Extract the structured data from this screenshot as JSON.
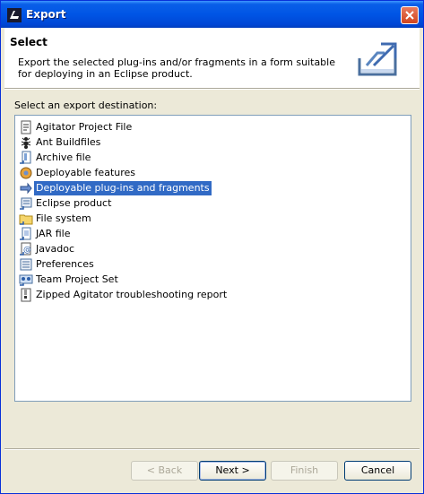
{
  "window": {
    "title": "Export"
  },
  "header": {
    "title": "Select",
    "description": "Export the selected plug-ins and/or fragments in a form suitable for deploying in an Eclipse product."
  },
  "destination": {
    "label": "Select an export destination:",
    "items": [
      {
        "label": "Agitator Project File",
        "icon": "agitator-project-icon",
        "selected": false
      },
      {
        "label": "Ant Buildfiles",
        "icon": "ant-icon",
        "selected": false
      },
      {
        "label": "Archive file",
        "icon": "archive-icon",
        "selected": false
      },
      {
        "label": "Deployable features",
        "icon": "feature-icon",
        "selected": false
      },
      {
        "label": "Deployable plug-ins and fragments",
        "icon": "plugin-icon",
        "selected": true
      },
      {
        "label": "Eclipse product",
        "icon": "product-icon",
        "selected": false
      },
      {
        "label": "File system",
        "icon": "folder-icon",
        "selected": false
      },
      {
        "label": "JAR file",
        "icon": "jar-icon",
        "selected": false
      },
      {
        "label": "Javadoc",
        "icon": "javadoc-icon",
        "selected": false
      },
      {
        "label": "Preferences",
        "icon": "preferences-icon",
        "selected": false
      },
      {
        "label": "Team Project Set",
        "icon": "team-icon",
        "selected": false
      },
      {
        "label": "Zipped Agitator troubleshooting report",
        "icon": "zip-report-icon",
        "selected": false
      }
    ]
  },
  "buttons": {
    "back": "< Back",
    "next": "Next >",
    "finish": "Finish",
    "cancel": "Cancel"
  },
  "colors": {
    "titlebar": "#0055e5",
    "selection": "#316ac5",
    "dialog": "#ece9d8"
  }
}
